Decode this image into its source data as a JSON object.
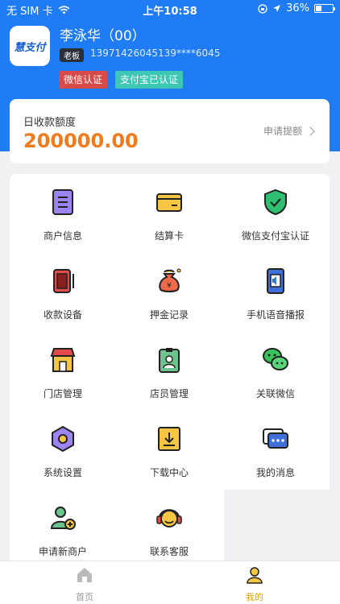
{
  "status_bar": {
    "carrier": "无 SIM 卡",
    "time": "上午10:58",
    "battery": "36%",
    "battery_level_percent": 36
  },
  "profile": {
    "logo_text": "慧支付",
    "name": "李泳华（00）",
    "role": "老板",
    "phone": "13971426045",
    "phone_masked": "139****6045",
    "tags": [
      "微信认证",
      "支付宝已认证"
    ]
  },
  "amount_card": {
    "label": "日收款额度",
    "value": "200000.00",
    "withdraw_label": "申请提额"
  },
  "menu": [
    {
      "label": "商户信息",
      "icon": "merchant-info-icon"
    },
    {
      "label": "结算卡",
      "icon": "bank-card-icon"
    },
    {
      "label": "微信支付宝认证",
      "icon": "shield-check-icon"
    },
    {
      "label": "收款设备",
      "icon": "pos-device-icon"
    },
    {
      "label": "押金记录",
      "icon": "deposit-bag-icon"
    },
    {
      "label": "手机语音播报",
      "icon": "phone-speaker-icon"
    },
    {
      "label": "门店管理",
      "icon": "store-icon"
    },
    {
      "label": "店员管理",
      "icon": "staff-badge-icon"
    },
    {
      "label": "关联微信",
      "icon": "wechat-icon"
    },
    {
      "label": "系统设置",
      "icon": "settings-hex-icon"
    },
    {
      "label": "下载中心",
      "icon": "download-box-icon"
    },
    {
      "label": "我的消息",
      "icon": "message-icon"
    },
    {
      "label": "申请新商户",
      "icon": "add-user-icon"
    },
    {
      "label": "联系客服",
      "icon": "headset-icon"
    }
  ],
  "tabbar": {
    "home": "首页",
    "mine": "我的"
  },
  "colors": {
    "header_blue": "#1f7cf5",
    "amount_orange": "#f07a1c",
    "active_tab": "#e0a400"
  }
}
